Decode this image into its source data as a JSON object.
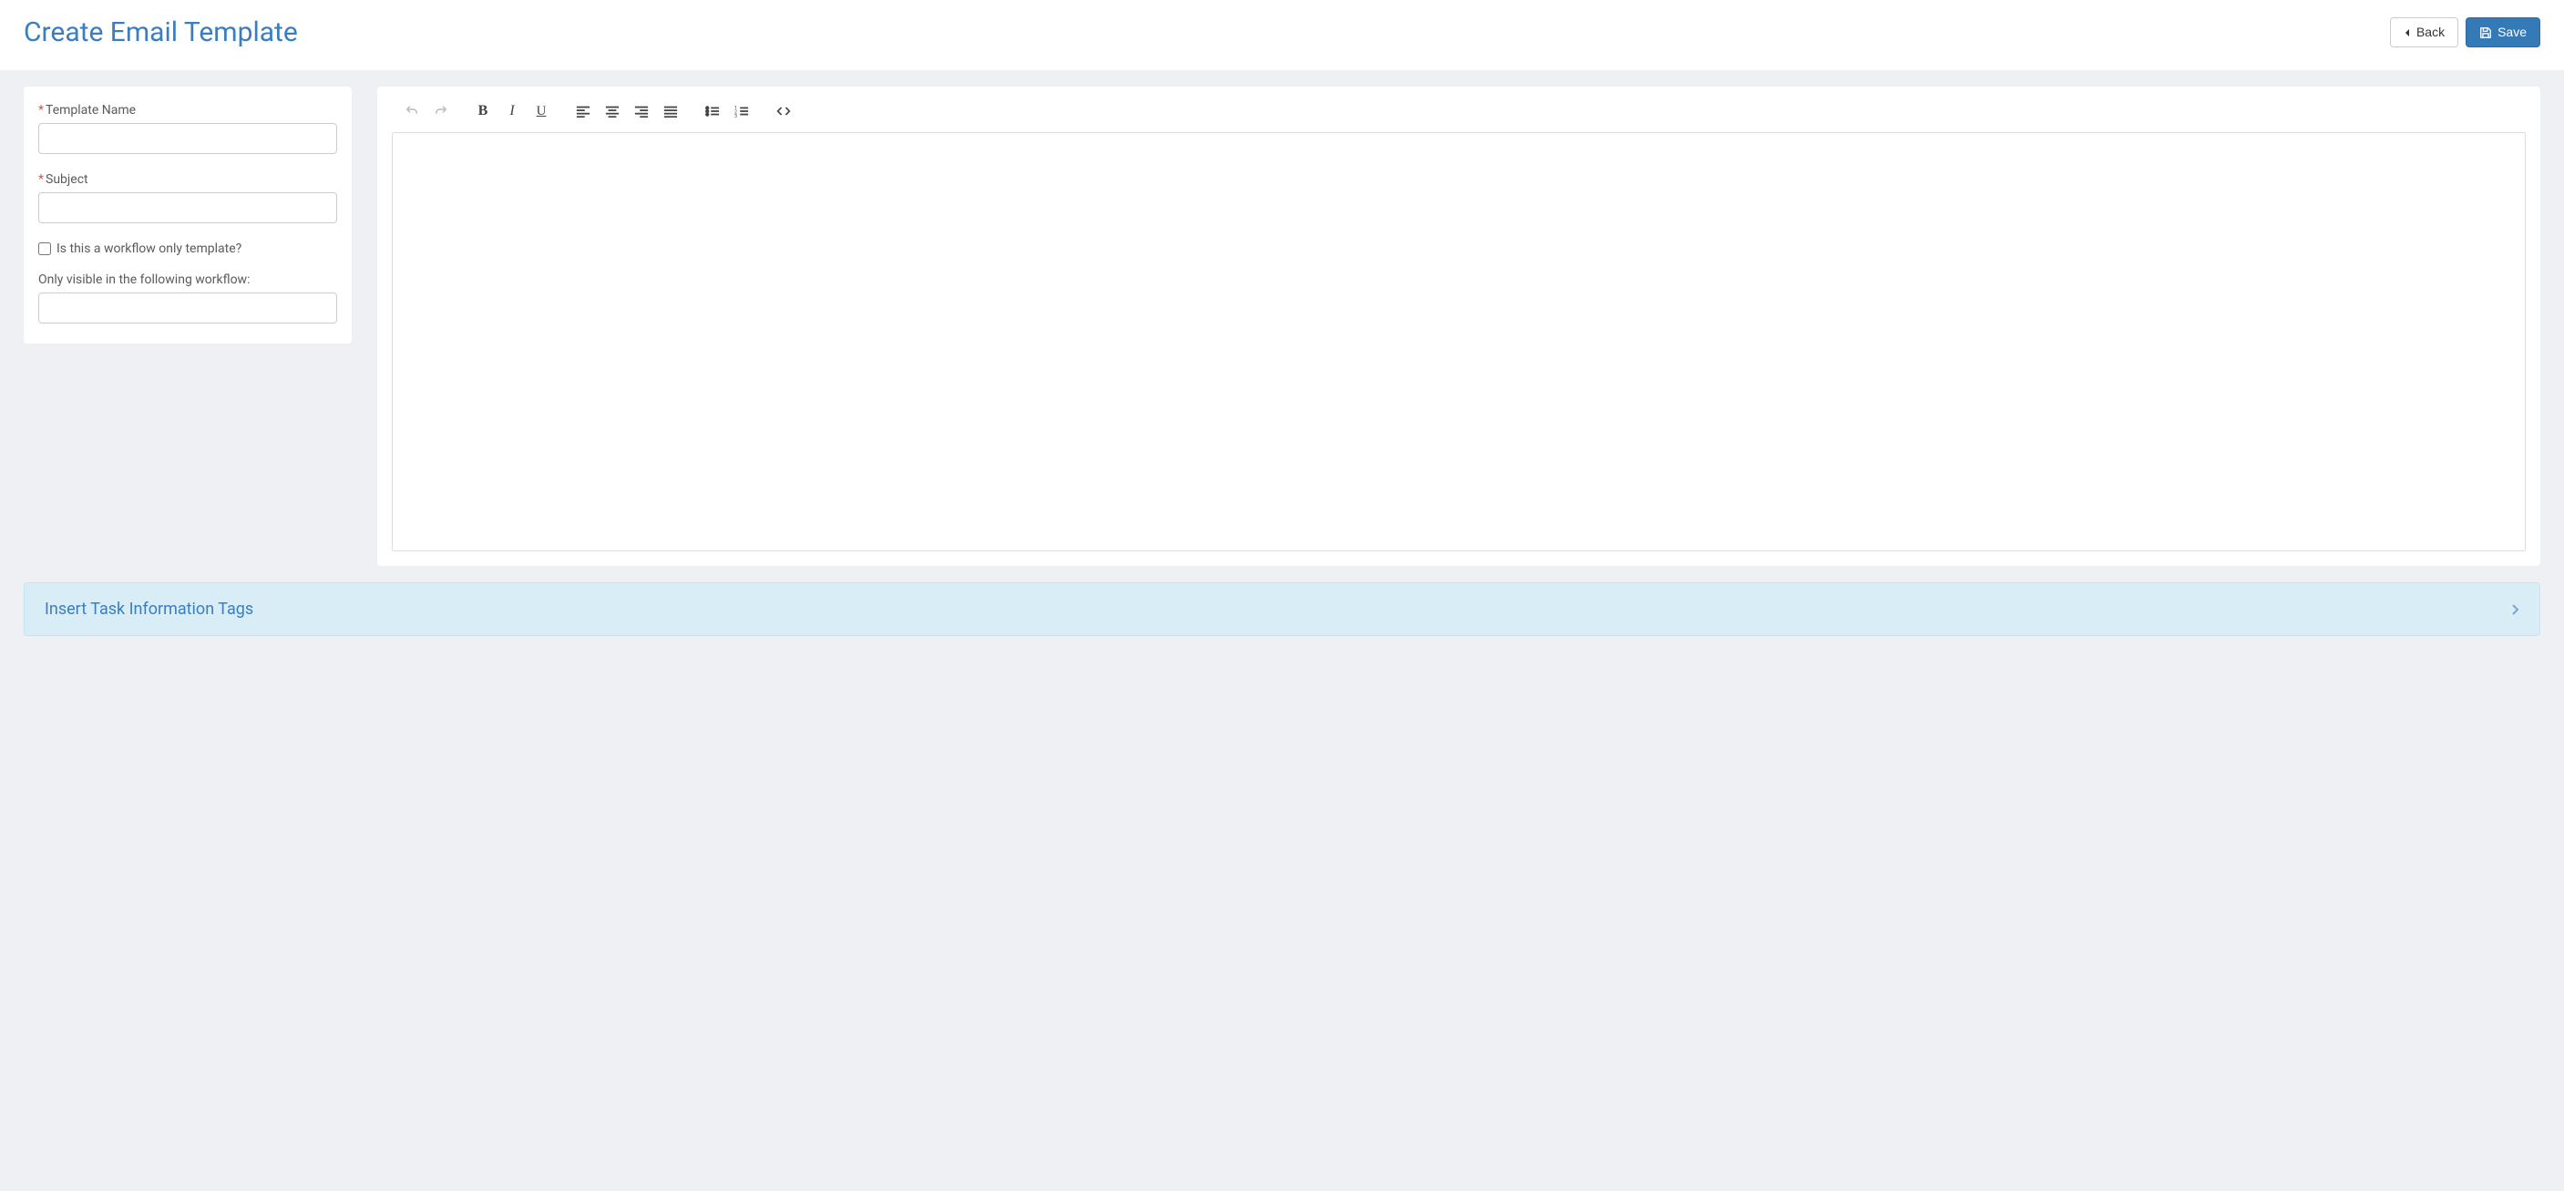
{
  "header": {
    "title": "Create Email Template",
    "back_label": "Back",
    "save_label": "Save"
  },
  "sidebar": {
    "template_name_label": "Template Name",
    "template_name_value": "",
    "subject_label": "Subject",
    "subject_value": "",
    "workflow_only_label": "Is this a workflow only template?",
    "workflow_only_checked": false,
    "visible_workflow_label": "Only visible in the following workflow:",
    "visible_workflow_value": ""
  },
  "editor": {
    "content": "",
    "toolbar": {
      "undo": "Undo",
      "redo": "Redo",
      "bold": "Bold",
      "italic": "Italic",
      "underline": "Underline",
      "align_left": "Align left",
      "align_center": "Align center",
      "align_right": "Align right",
      "align_justify": "Justify",
      "list_ul": "Bullet list",
      "list_ol": "Numbered list",
      "code": "Source code"
    }
  },
  "accordion": {
    "tags_title": "Insert Task Information Tags"
  }
}
